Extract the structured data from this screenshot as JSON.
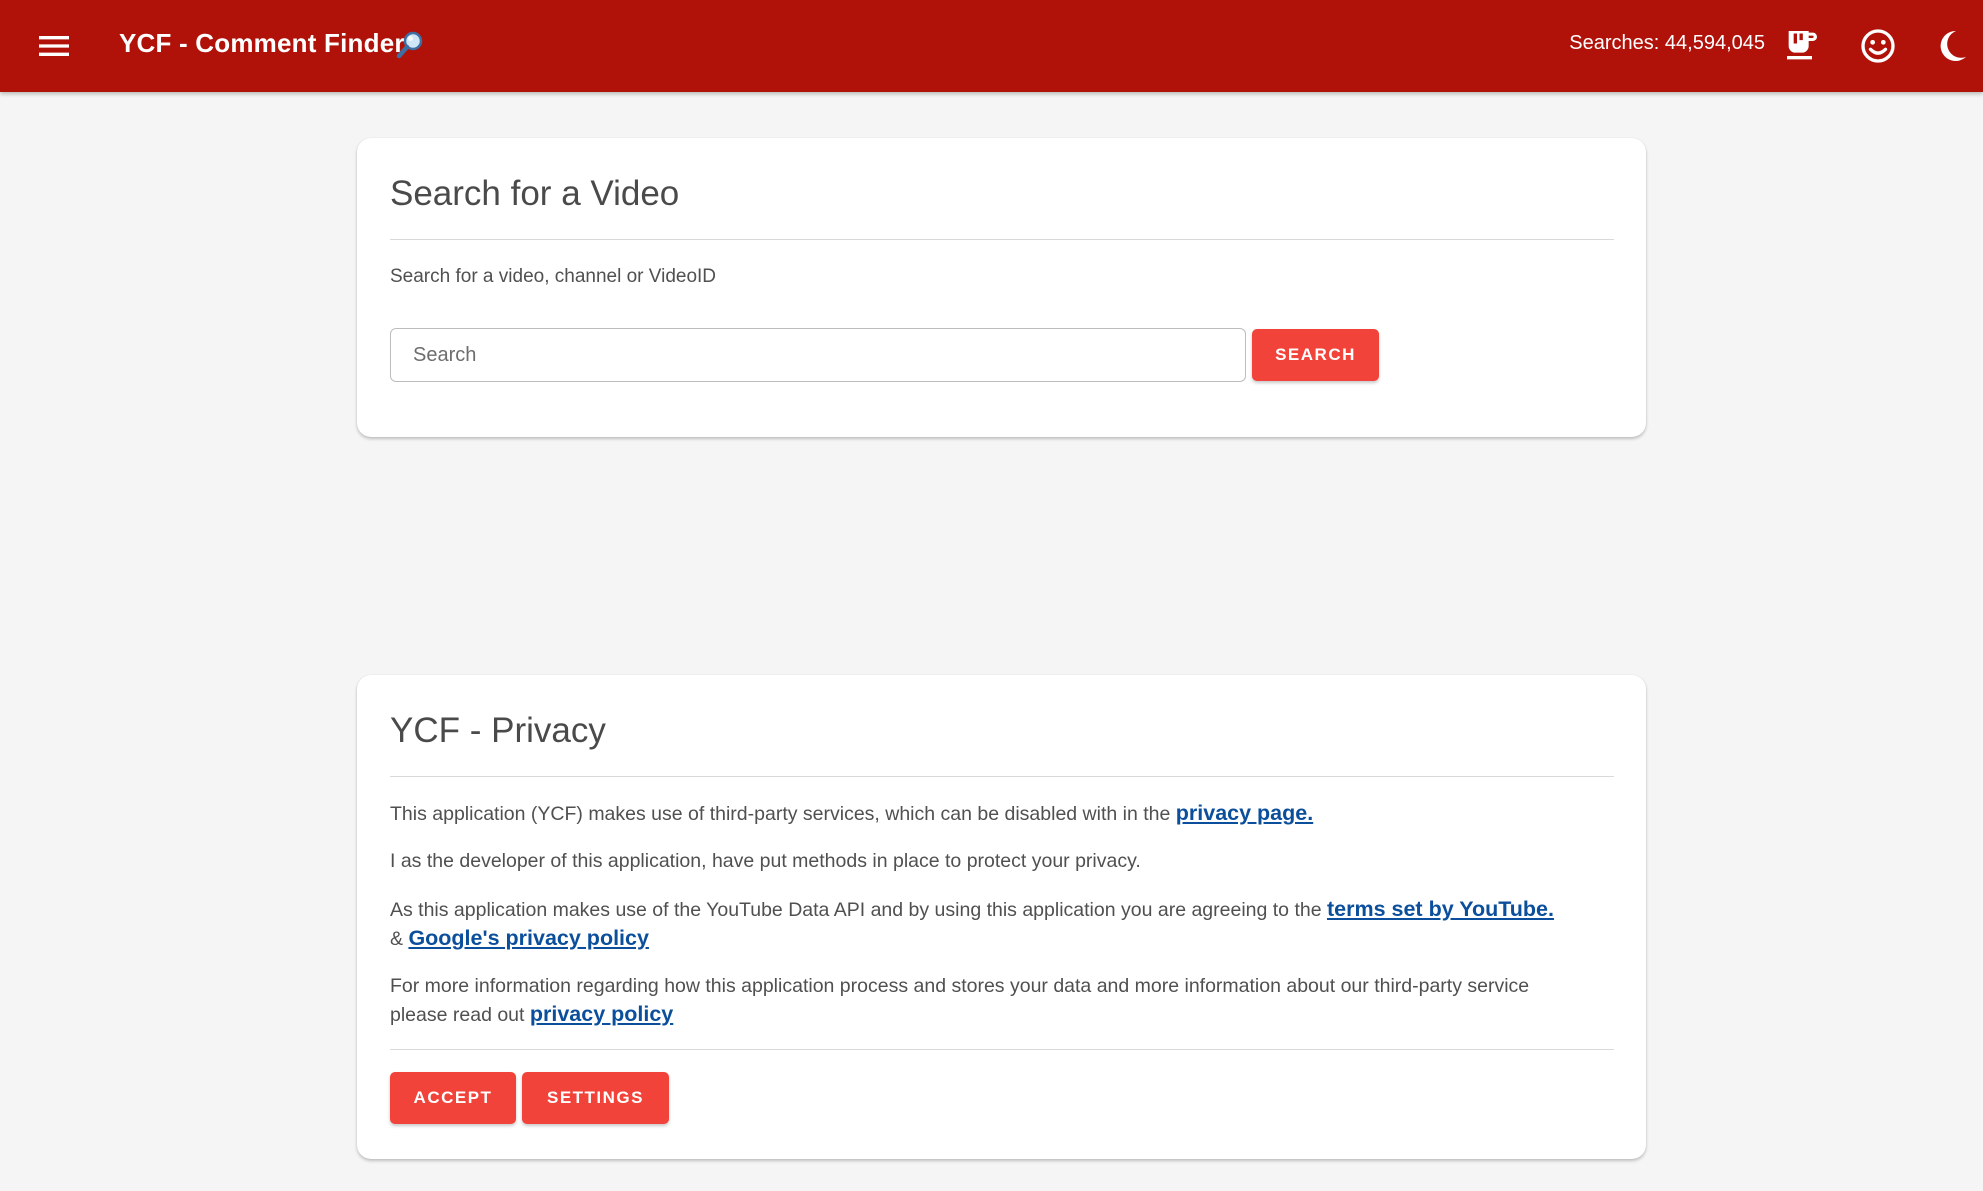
{
  "appbar": {
    "title": "YCF - Comment Finder",
    "search_count": "Searches: 44,594,045",
    "bg_color": "#b0120a",
    "icons": [
      "menu-icon",
      "magnifier-icon",
      "coffee-icon",
      "smiley-icon",
      "moon-icon"
    ]
  },
  "search_card": {
    "title": "Search for a Video",
    "subtitle": "Search for a video, channel or VideoID",
    "input_placeholder": "Search",
    "input_value": "",
    "button_label": "SEARCH"
  },
  "privacy_card": {
    "title": "YCF - Privacy",
    "p1_text": "This application (YCF) makes use of third-party services, which can be disabled with in the ",
    "p1_link": "privacy page.",
    "p2_text": "I as the developer of this application, have put methods in place to protect your privacy.",
    "p3_text": "As this application makes use of the YouTube Data API and by using this application you are agreeing to the ",
    "p3_link1": "terms set by YouTube.",
    "p3_between": " & ",
    "p3_link2": "Google's privacy policy",
    "p4_text": "For more information regarding how this application process and stores your data and more information about our third-party service please read out ",
    "p4_link": "privacy policy",
    "accept_label": "ACCEPT",
    "settings_label": "SETTINGS"
  },
  "colors": {
    "accent": "#f2433a",
    "link": "#0b4f9c",
    "background": "#f6f5f6"
  }
}
